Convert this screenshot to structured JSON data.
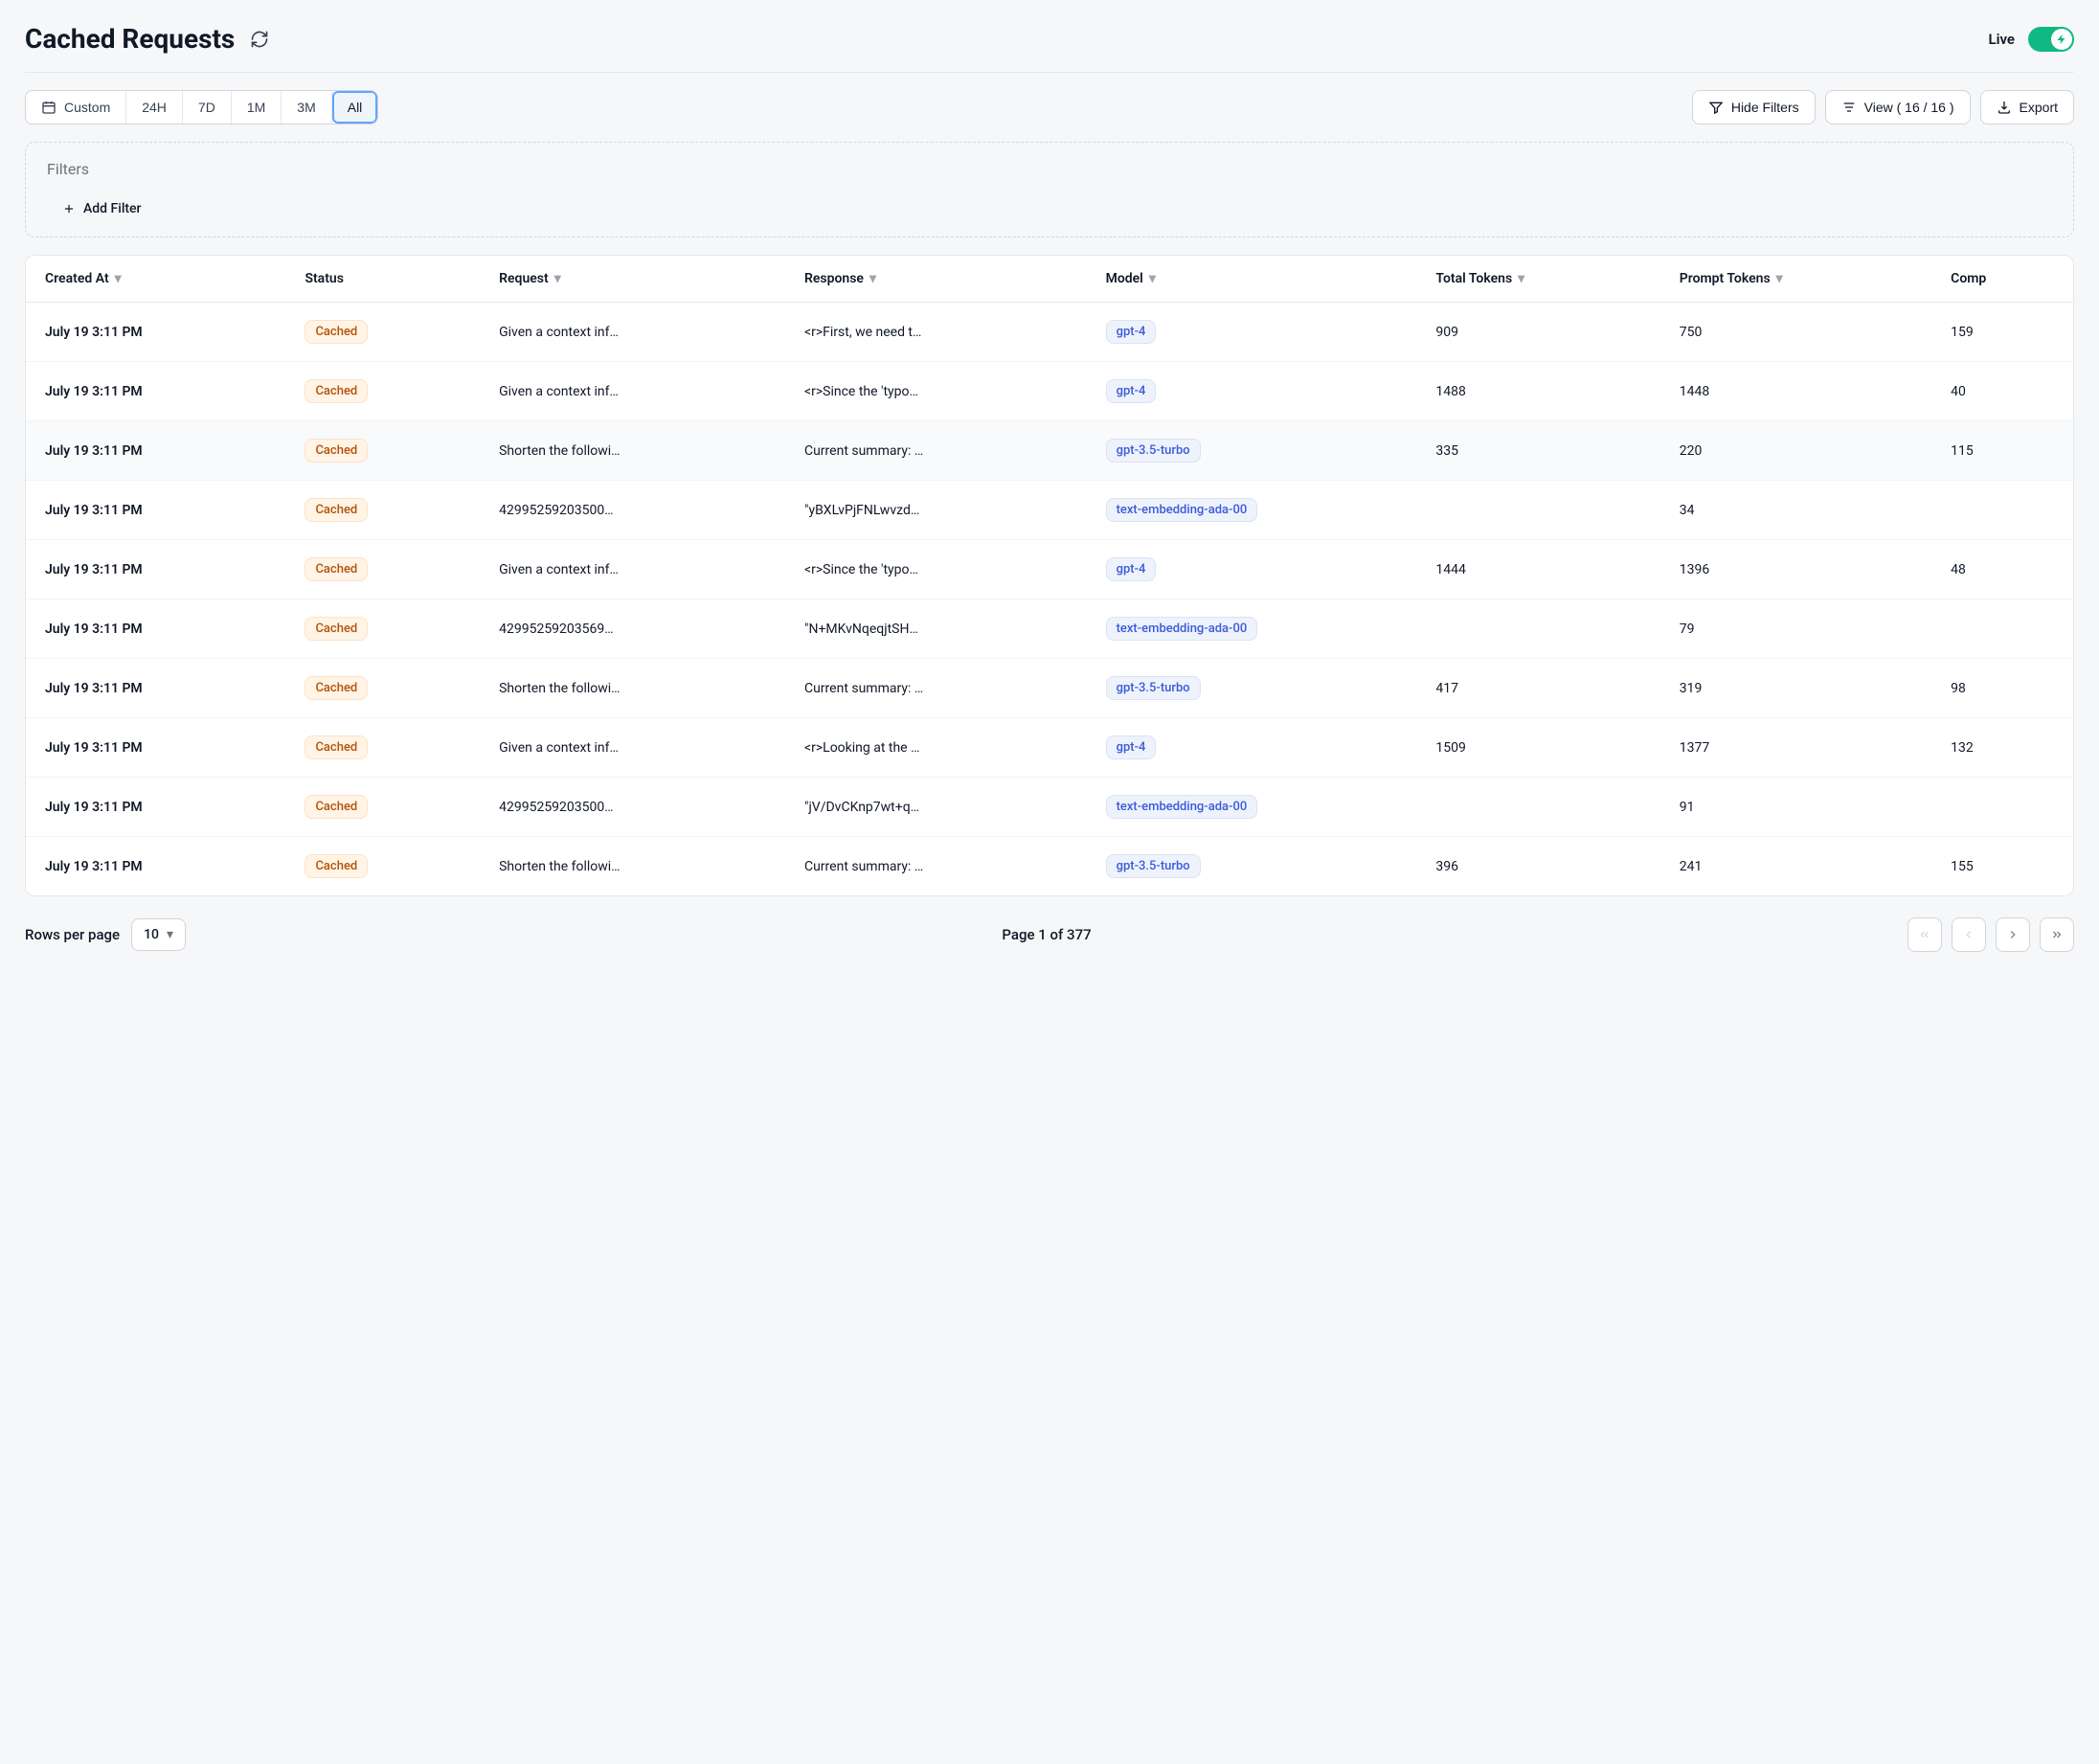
{
  "header": {
    "title": "Cached Requests",
    "live_label": "Live",
    "live_on": true
  },
  "time_ranges": {
    "custom": "Custom",
    "h24": "24H",
    "d7": "7D",
    "m1": "1M",
    "m3": "3M",
    "all": "All",
    "active": "all"
  },
  "toolbar": {
    "hide_filters": "Hide Filters",
    "view_label": "View ( 16 / 16 )",
    "export": "Export"
  },
  "filters": {
    "title": "Filters",
    "add_filter": "Add Filter"
  },
  "columns": {
    "created_at": "Created At",
    "status": "Status",
    "request": "Request",
    "response": "Response",
    "model": "Model",
    "total_tokens": "Total Tokens",
    "prompt_tokens": "Prompt Tokens",
    "completion_tokens": "Comp"
  },
  "rows": [
    {
      "created_at": "July 19 3:11 PM",
      "status": "Cached",
      "request": "Given a context inf…",
      "response": "<r>First, we need t…",
      "model": "gpt-4",
      "total": "909",
      "prompt": "750",
      "comp": "159",
      "hl": false
    },
    {
      "created_at": "July 19 3:11 PM",
      "status": "Cached",
      "request": "Given a context inf…",
      "response": "<r>Since the 'typo…",
      "model": "gpt-4",
      "total": "1488",
      "prompt": "1448",
      "comp": "40",
      "hl": false
    },
    {
      "created_at": "July 19 3:11 PM",
      "status": "Cached",
      "request": "Shorten the followi…",
      "response": "Current summary: …",
      "model": "gpt-3.5-turbo",
      "total": "335",
      "prompt": "220",
      "comp": "115",
      "hl": true
    },
    {
      "created_at": "July 19 3:11 PM",
      "status": "Cached",
      "request": "42995259203500…",
      "response": "\"yBXLvPjFNLwvzd…",
      "model": "text-embedding-ada-00",
      "total": "",
      "prompt": "34",
      "comp": "",
      "hl": false
    },
    {
      "created_at": "July 19 3:11 PM",
      "status": "Cached",
      "request": "Given a context inf…",
      "response": "<r>Since the 'typo…",
      "model": "gpt-4",
      "total": "1444",
      "prompt": "1396",
      "comp": "48",
      "hl": false
    },
    {
      "created_at": "July 19 3:11 PM",
      "status": "Cached",
      "request": "42995259203569…",
      "response": "\"N+MKvNqeqjtSH…",
      "model": "text-embedding-ada-00",
      "total": "",
      "prompt": "79",
      "comp": "",
      "hl": false
    },
    {
      "created_at": "July 19 3:11 PM",
      "status": "Cached",
      "request": "Shorten the followi…",
      "response": "Current summary: …",
      "model": "gpt-3.5-turbo",
      "total": "417",
      "prompt": "319",
      "comp": "98",
      "hl": false
    },
    {
      "created_at": "July 19 3:11 PM",
      "status": "Cached",
      "request": "Given a context inf…",
      "response": "<r>Looking at the …",
      "model": "gpt-4",
      "total": "1509",
      "prompt": "1377",
      "comp": "132",
      "hl": false
    },
    {
      "created_at": "July 19 3:11 PM",
      "status": "Cached",
      "request": "42995259203500…",
      "response": "\"jV/DvCKnp7wt+q…",
      "model": "text-embedding-ada-00",
      "total": "",
      "prompt": "91",
      "comp": "",
      "hl": false
    },
    {
      "created_at": "July 19 3:11 PM",
      "status": "Cached",
      "request": "Shorten the followi…",
      "response": "Current summary: …",
      "model": "gpt-3.5-turbo",
      "total": "396",
      "prompt": "241",
      "comp": "155",
      "hl": false
    }
  ],
  "pagination": {
    "rows_per_page_label": "Rows per page",
    "rows_per_page_value": "10",
    "page_info": "Page 1 of 377"
  }
}
